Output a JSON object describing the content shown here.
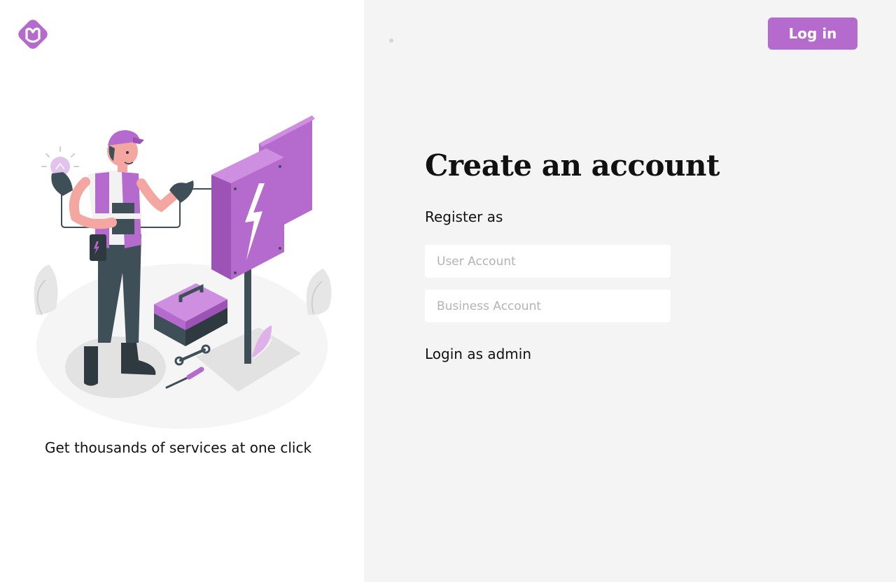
{
  "brand": {
    "logo_icon": "brand-logo-icon",
    "accent_color": "#b56acd"
  },
  "illustration": {
    "icon": "electrician-illustration"
  },
  "left": {
    "tagline": "Get thousands of services at one click"
  },
  "header": {
    "login_label": "Log in"
  },
  "form": {
    "title": "Create an account",
    "register_label": "Register as",
    "user_account_placeholder": "User Account",
    "business_account_placeholder": "Business Account",
    "admin_login_label": "Login as admin"
  }
}
